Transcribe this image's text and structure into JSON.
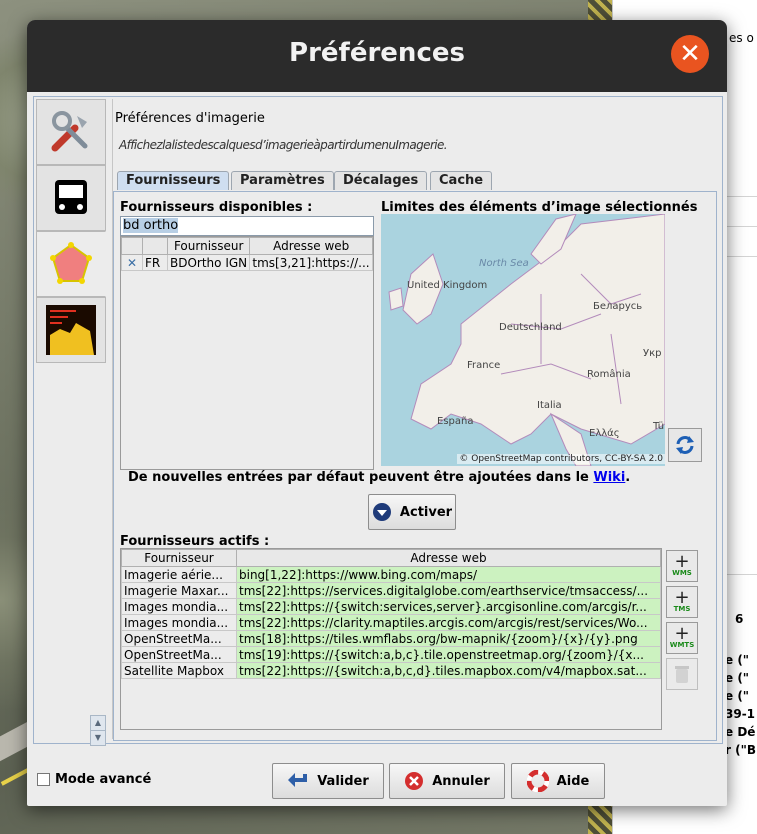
{
  "dialog": {
    "title": "Préférences",
    "section_title": "Préférences d'imagerie",
    "section_desc": "Affichezlalistedescalquesd’imagerieàpartirdumenuImagerie.",
    "tabs": [
      "Fournisseurs",
      "Paramètres",
      "Décalages",
      "Cache"
    ],
    "available_label": "Fournisseurs disponibles :",
    "search_value": "bd ortho",
    "available_columns": [
      "Fournisseur",
      "Adresse web"
    ],
    "available_rows": [
      {
        "country": "FR",
        "provider": "BDOrtho IGN",
        "url": "tms[3,21]:https://..."
      }
    ],
    "map_label": "Limites des éléments d’image sélectionnés",
    "map_attribution": "© OpenStreetMap contributors, CC-BY-SA 2.0",
    "map_places": [
      "North Sea",
      "United Kingdom",
      "Беларусь",
      "Deutschland",
      "France",
      "Укр",
      "România",
      "España",
      "Italia",
      "Ελλάς",
      "Tü"
    ],
    "wiki_text": "De nouvelles entrées par défaut peuvent être ajoutées dans le",
    "wiki_link": "Wiki",
    "wiki_end": ".",
    "activate_label": "Activer",
    "active_label": "Fournisseurs actifs :",
    "active_columns": [
      "Fournisseur",
      "Adresse web"
    ],
    "active_rows": [
      {
        "provider": "Imagerie aérie...",
        "url": "bing[1,22]:https://www.bing.com/maps/"
      },
      {
        "provider": "Imagerie Maxar...",
        "url": "tms[22]:https://services.digitalglobe.com/earthservice/tmsaccess/..."
      },
      {
        "provider": "Images mondia...",
        "url": "tms[22]:https://{switch:services,server}.arcgisonline.com/arcgis/r..."
      },
      {
        "provider": "Images mondia...",
        "url": "tms[22]:https://clarity.maptiles.arcgis.com/arcgis/rest/services/Wo..."
      },
      {
        "provider": "OpenStreetMa...",
        "url": "tms[18]:https://tiles.wmflabs.org/bw-mapnik/{zoom}/{x}/{y}.png"
      },
      {
        "provider": "OpenStreetMa...",
        "url": "tms[19]:https://{switch:a,b,c}.tile.openstreetmap.org/{zoom}/{x..."
      },
      {
        "provider": "Satellite Mapbox",
        "url": "tms[22]:https://{switch:a,b,c,d}.tiles.mapbox.com/v4/mapbox.sat..."
      }
    ],
    "side_buttons": [
      "WMS",
      "TMS",
      "WMTS"
    ],
    "expert_mode": "Mode avancé",
    "ok_label": "Valider",
    "cancel_label": "Annuler",
    "help_label": "Aide"
  },
  "background": {
    "right_snippets": [
      "es o",
      "6",
      "e (\"",
      "e (\"",
      "e (\"",
      "39-1",
      "e Dé",
      "r (\"B"
    ]
  },
  "colors": {
    "accent_close": "#e95420",
    "url_cell_green": "#ccf2c0",
    "titlebar": "#2b2b2b"
  }
}
